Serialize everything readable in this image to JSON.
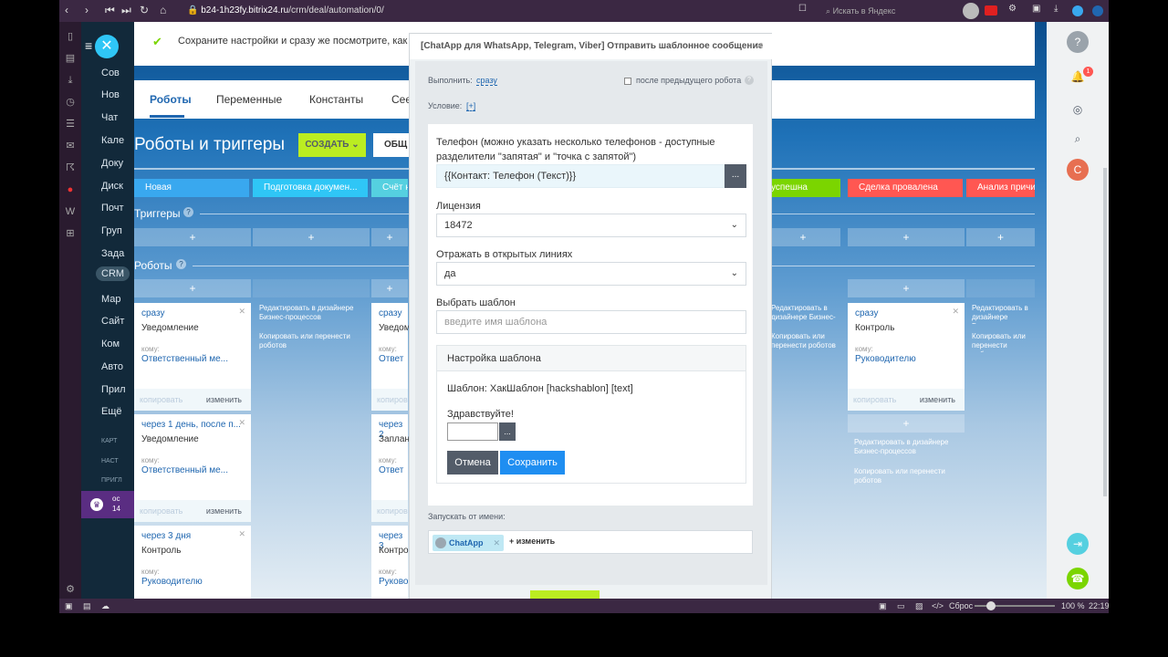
{
  "browser": {
    "url": "b24-1h23fy.bitrix24.ru/crm/deal/automation/0/",
    "url_host": "b24-1h23fy.bitrix24.ru",
    "url_path": "/crm/deal/automation/0/",
    "search_placeholder": "Искать в Яндекс",
    "notification_count": "1"
  },
  "left_menu": {
    "items": [
      "Сов",
      "Нов",
      "Чат",
      "Кале",
      "Доку",
      "Диск",
      "Почт",
      "Груп",
      "Зада",
      "CRM",
      "Мар",
      "Сайт",
      "Ком",
      "Авто",
      "Прил",
      "Ещё",
      "КАРТ",
      "НАСТ",
      "ПРИГЛ"
    ],
    "badge": {
      "line1": "ос",
      "line2": "14"
    }
  },
  "notice": {
    "text": "Сохраните настройки и сразу же посмотрите, как работа"
  },
  "tabs": [
    "Роботы",
    "Переменные",
    "Константы",
    "Сеє"
  ],
  "page": {
    "title": "Роботы и триггеры",
    "create_button": "СОЗДАТЬ",
    "common_button": "ОБЩ"
  },
  "stages": [
    {
      "label": "Новая",
      "color": "#39a8ef"
    },
    {
      "label": "Подготовка докумен...",
      "color": "#2fc6f6"
    },
    {
      "label": "Счёт н",
      "color": "#55d0e0"
    },
    {
      "label": "успешна",
      "color": "#7bd500"
    },
    {
      "label": "Сделка провалена",
      "color": "#ff5752"
    },
    {
      "label": "Анализ причи",
      "color": "#ff5752"
    }
  ],
  "sections": {
    "triggers": "Триггеры",
    "robots": "Роботы"
  },
  "robot_cards": [
    {
      "when": "сразу",
      "name": "Уведомление",
      "to_label": "кому:",
      "to": "Ответственный ме...",
      "copy": "копировать",
      "edit": "изменить"
    },
    {
      "when": "через 1 день, после п...",
      "name": "Уведомление",
      "to_label": "кому:",
      "to": "Ответственный ме...",
      "copy": "копировать",
      "edit": "изменить"
    },
    {
      "when": "через 3 дня",
      "name": "Контроль",
      "to_label": "кому:",
      "to": "Руководителю",
      "copy": "копировать",
      "edit": "изменить"
    },
    {
      "when": "сразу",
      "name": "Уведом",
      "to_label": "кому:",
      "to": "Ответ",
      "copy": "копиров",
      "edit": ""
    },
    {
      "when": "через 2",
      "name": "Заплан",
      "to_label": "кому:",
      "to": "Ответ",
      "copy": "копиров",
      "edit": ""
    },
    {
      "when": "через 3",
      "name": "Контро",
      "to_label": "кому:",
      "to": "Руково",
      "copy": "",
      "edit": ""
    },
    {
      "when": "сразу",
      "name": "Контроль",
      "to_label": "кому:",
      "to": "Руководителю",
      "copy": "копировать",
      "edit": "изменить"
    }
  ],
  "designer_links": {
    "edit": "Редактировать в дизайнере Бизнес-процессов",
    "copy": "Копировать или перенести роботов"
  },
  "modal": {
    "title": "[ChatApp для WhatsApp, Telegram, Viber] Отправить шаблонное сообщение",
    "run_label": "Выполнить:",
    "run_value": "сразу",
    "after_prev": "после предыдущего робота",
    "condition_label": "Условие:",
    "condition_value": "[+]",
    "phone_label": "Телефон (можно указать несколько телефонов - доступные разделители \"запятая\" и \"точка с запятой\")",
    "phone_value": "{{Контакт: Телефон (Текст)}}",
    "dots": "...",
    "license_label": "Лицензия",
    "license_value": "18472",
    "openlines_label": "Отражать в открытых линиях",
    "openlines_value": "да",
    "template_label": "Выбрать шаблон",
    "template_placeholder": "введите имя шаблона",
    "template_settings_title": "Настройка шаблона",
    "template_info": "Шаблон: ХакШаблон [hackshablon] [text]",
    "greeting": "Здравствуйте!",
    "cancel": "Отмена",
    "save": "Сохранить",
    "run_as_label": "Запускать от имени:",
    "run_as_user": "ChatApp",
    "change": "+ изменить"
  },
  "status": {
    "reset": "Сброс",
    "zoom": "100 %",
    "time": "22:19"
  }
}
